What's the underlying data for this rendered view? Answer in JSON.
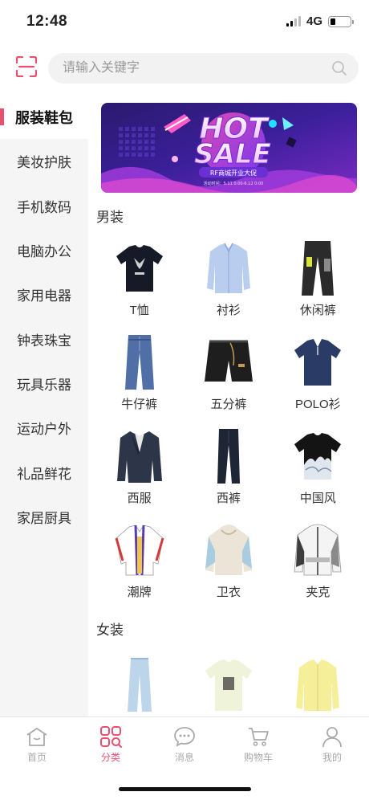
{
  "status_bar": {
    "time": "12:48",
    "network": "4G"
  },
  "header": {
    "search_placeholder": "请输入关键字"
  },
  "colors": {
    "accent": "#e8506f",
    "sidebar_bg": "#f5f5f5",
    "muted": "#aaaaaa"
  },
  "sidebar": {
    "items": [
      {
        "label": "服装鞋包",
        "active": true
      },
      {
        "label": "美妆护肤"
      },
      {
        "label": "手机数码"
      },
      {
        "label": "电脑办公"
      },
      {
        "label": "家用电器"
      },
      {
        "label": "钟表珠宝"
      },
      {
        "label": "玩具乐器"
      },
      {
        "label": "运动户外"
      },
      {
        "label": "礼品鲜花"
      },
      {
        "label": "家居厨具"
      }
    ]
  },
  "banner": {
    "line1": "HOT",
    "line2": "SALE",
    "subtitle": "RF商城开业大促",
    "small": "活动时间：5.11 0:00-6.12 0:00"
  },
  "sections": [
    {
      "title": "男装",
      "items": [
        {
          "label": "T恤",
          "icon": "tshirt-icon"
        },
        {
          "label": "衬衫",
          "icon": "shirt-icon"
        },
        {
          "label": "休闲裤",
          "icon": "casual-pants-icon"
        },
        {
          "label": "牛仔裤",
          "icon": "jeans-icon"
        },
        {
          "label": "五分裤",
          "icon": "shorts-icon"
        },
        {
          "label": "POLO衫",
          "icon": "polo-icon"
        },
        {
          "label": "西服",
          "icon": "suit-icon"
        },
        {
          "label": "西裤",
          "icon": "trousers-icon"
        },
        {
          "label": "中国风",
          "icon": "chinese-style-tee-icon"
        },
        {
          "label": "潮牌",
          "icon": "trendy-jacket-icon"
        },
        {
          "label": "卫衣",
          "icon": "hoodie-icon"
        },
        {
          "label": "夹克",
          "icon": "jacket-icon"
        }
      ]
    },
    {
      "title": "女装",
      "items": [
        {
          "label": "",
          "icon": "women-jeans-icon"
        },
        {
          "label": "",
          "icon": "women-tee-icon"
        },
        {
          "label": "",
          "icon": "women-shirt-icon"
        }
      ]
    }
  ],
  "tabbar": {
    "items": [
      {
        "label": "首页",
        "icon": "home-icon"
      },
      {
        "label": "分类",
        "icon": "category-icon",
        "active": true
      },
      {
        "label": "消息",
        "icon": "message-icon"
      },
      {
        "label": "购物车",
        "icon": "cart-icon"
      },
      {
        "label": "我的",
        "icon": "profile-icon"
      }
    ]
  }
}
